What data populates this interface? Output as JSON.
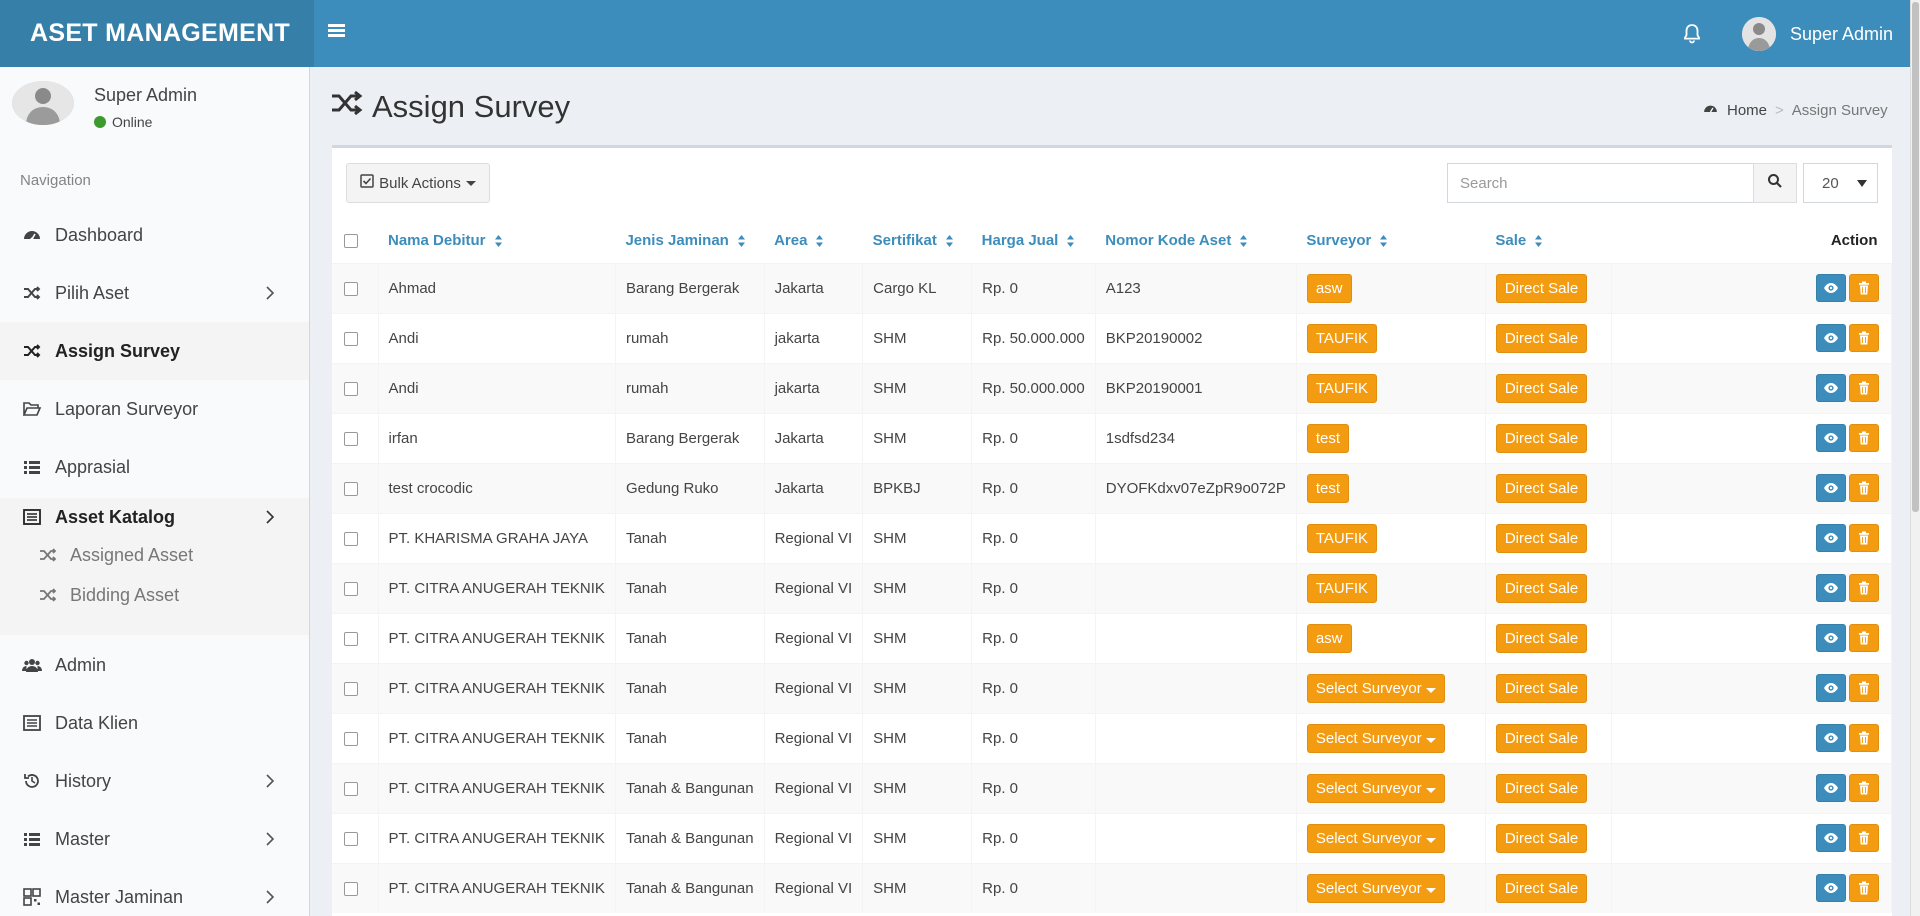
{
  "app": {
    "logo": "ASET MANAGEMENT",
    "username": "Super Admin"
  },
  "sidebar": {
    "user_name": "Super Admin",
    "status": "Online",
    "nav_header": "Navigation",
    "items": [
      {
        "label": "Dashboard"
      },
      {
        "label": "Pilih Aset"
      },
      {
        "label": "Assign Survey"
      },
      {
        "label": "Laporan Surveyor"
      },
      {
        "label": "Apprasial"
      },
      {
        "label": "Asset Katalog"
      },
      {
        "label": "Admin"
      },
      {
        "label": "Data Klien"
      },
      {
        "label": "History"
      },
      {
        "label": "Master"
      },
      {
        "label": "Master Jaminan"
      }
    ],
    "sub_items": [
      {
        "label": "Assigned Asset"
      },
      {
        "label": "Bidding Asset"
      }
    ]
  },
  "page": {
    "title": "Assign Survey",
    "breadcrumb_home": "Home",
    "breadcrumb_sep": ">",
    "breadcrumb_current": "Assign Survey"
  },
  "toolbar": {
    "bulk_label": "Bulk Actions",
    "search_placeholder": "Search",
    "page_size": "20"
  },
  "table": {
    "columns": [
      "Nama Debitur",
      "Jenis Jaminan",
      "Area",
      "Sertifikat",
      "Harga Jual",
      "Nomor Kode Aset",
      "Surveyor",
      "Sale",
      "Action"
    ],
    "rows": [
      {
        "nama": "Ahmad",
        "jenis": "Barang Bergerak",
        "area": "Jakarta",
        "sertifikat": "Cargo KL",
        "harga": "Rp. 0",
        "kode": "A123",
        "surveyor": "asw",
        "sale": "Direct Sale"
      },
      {
        "nama": "Andi",
        "jenis": "rumah",
        "area": "jakarta",
        "sertifikat": "SHM",
        "harga": "Rp. 50.000.000",
        "kode": "BKP20190002",
        "surveyor": "TAUFIK",
        "sale": "Direct Sale"
      },
      {
        "nama": "Andi",
        "jenis": "rumah",
        "area": "jakarta",
        "sertifikat": "SHM",
        "harga": "Rp. 50.000.000",
        "kode": "BKP20190001",
        "surveyor": "TAUFIK",
        "sale": "Direct Sale"
      },
      {
        "nama": "irfan",
        "jenis": "Barang Bergerak",
        "area": "Jakarta",
        "sertifikat": "SHM",
        "harga": "Rp. 0",
        "kode": "1sdfsd234",
        "surveyor": "test",
        "sale": "Direct Sale"
      },
      {
        "nama": "test crocodic",
        "jenis": "Gedung Ruko",
        "area": "Jakarta",
        "sertifikat": "BPKBJ",
        "harga": "Rp. 0",
        "kode": "DYOFKdxv07eZpR9o072P",
        "surveyor": "test",
        "sale": "Direct Sale"
      },
      {
        "nama": "PT. KHARISMA GRAHA JAYA",
        "jenis": "Tanah",
        "area": "Regional VI",
        "sertifikat": "SHM",
        "harga": "Rp. 0",
        "kode": "",
        "surveyor": "TAUFIK",
        "sale": "Direct Sale"
      },
      {
        "nama": "PT. CITRA ANUGERAH TEKNIK",
        "jenis": "Tanah",
        "area": "Regional VI",
        "sertifikat": "SHM",
        "harga": "Rp. 0",
        "kode": "",
        "surveyor": "TAUFIK",
        "sale": "Direct Sale"
      },
      {
        "nama": "PT. CITRA ANUGERAH TEKNIK",
        "jenis": "Tanah",
        "area": "Regional VI",
        "sertifikat": "SHM",
        "harga": "Rp. 0",
        "kode": "",
        "surveyor": "asw",
        "sale": "Direct Sale"
      },
      {
        "nama": "PT. CITRA ANUGERAH TEKNIK",
        "jenis": "Tanah",
        "area": "Regional VI",
        "sertifikat": "SHM",
        "harga": "Rp. 0",
        "kode": "",
        "surveyor": "Select Surveyor",
        "sale": "Direct Sale"
      },
      {
        "nama": "PT. CITRA ANUGERAH TEKNIK",
        "jenis": "Tanah",
        "area": "Regional VI",
        "sertifikat": "SHM",
        "harga": "Rp. 0",
        "kode": "",
        "surveyor": "Select Surveyor",
        "sale": "Direct Sale"
      },
      {
        "nama": "PT. CITRA ANUGERAH TEKNIK",
        "jenis": "Tanah & Bangunan",
        "area": "Regional VI",
        "sertifikat": "SHM",
        "harga": "Rp. 0",
        "kode": "",
        "surveyor": "Select Surveyor",
        "sale": "Direct Sale"
      },
      {
        "nama": "PT. CITRA ANUGERAH TEKNIK",
        "jenis": "Tanah & Bangunan",
        "area": "Regional VI",
        "sertifikat": "SHM",
        "harga": "Rp. 0",
        "kode": "",
        "surveyor": "Select Surveyor",
        "sale": "Direct Sale"
      },
      {
        "nama": "PT. CITRA ANUGERAH TEKNIK",
        "jenis": "Tanah & Bangunan",
        "area": "Regional VI",
        "sertifikat": "SHM",
        "harga": "Rp. 0",
        "kode": "",
        "surveyor": "Select Surveyor",
        "sale": "Direct Sale"
      }
    ]
  },
  "colors": {
    "primary": "#3c8dbc",
    "logo_bg": "#367fa9",
    "warning": "#f39c12",
    "online": "#3c9a2e"
  }
}
